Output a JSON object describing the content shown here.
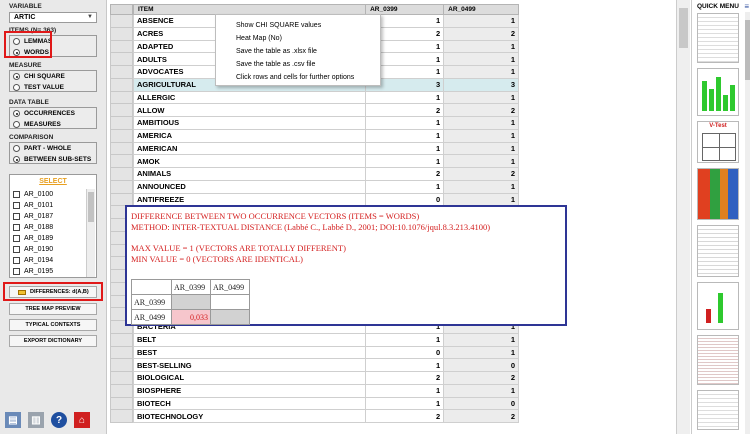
{
  "sidebar": {
    "variable_label": "VARIABLE",
    "variable_value": "ARTIC",
    "items_label": "ITEMS (N= 363)",
    "items_options": [
      "LEMMAS",
      "WORDS"
    ],
    "measure_label": "MEASURE",
    "measure_options": [
      "CHI SQUARE",
      "TEST VALUE"
    ],
    "data_table_label": "DATA TABLE",
    "data_table_options": [
      "OCCURRENCES",
      "MEASURES"
    ],
    "comparison_label": "COMPARISON",
    "comparison_options": [
      "PART - WHOLE",
      "BETWEEN SUB-SETS"
    ],
    "select_label": "SELECT",
    "select_items": [
      "AR_0100",
      "AR_0101",
      "AR_0187",
      "AR_0188",
      "AR_0189",
      "AR_0190",
      "AR_0194",
      "AR_0195"
    ],
    "differences_label": "DIFFERENCES: d(A,B)",
    "buttons": [
      "TREE MAP PREVIEW",
      "TYPICAL CONTEXTS",
      "EXPORT DICTIONARY"
    ]
  },
  "table": {
    "headers": [
      "ITEM",
      "AR_0399",
      "AR_0499"
    ],
    "rows": [
      [
        "ABSENCE",
        "1",
        "1"
      ],
      [
        "ACRES",
        "2",
        "2"
      ],
      [
        "ADAPTED",
        "1",
        "1"
      ],
      [
        "ADULTS",
        "1",
        "1"
      ],
      [
        "ADVOCATES",
        "1",
        "1"
      ],
      [
        "AGRICULTURAL",
        "3",
        "3"
      ],
      [
        "ALLERGIC",
        "1",
        "1"
      ],
      [
        "ALLOW",
        "2",
        "2"
      ],
      [
        "AMBITIOUS",
        "1",
        "1"
      ],
      [
        "AMERICA",
        "1",
        "1"
      ],
      [
        "AMERICAN",
        "1",
        "1"
      ],
      [
        "AMOK",
        "1",
        "1"
      ],
      [
        "ANIMALS",
        "2",
        "2"
      ],
      [
        "ANNOUNCED",
        "1",
        "1"
      ],
      [
        "ANTIFREEZE",
        "0",
        "1"
      ],
      [
        "",
        "",
        ""
      ],
      [
        "",
        "",
        ""
      ],
      [
        "",
        "",
        ""
      ],
      [
        "",
        "",
        ""
      ],
      [
        "",
        "",
        ""
      ],
      [
        "",
        "",
        ""
      ],
      [
        "",
        "",
        ""
      ],
      [
        "",
        "",
        ""
      ],
      [
        "",
        "",
        ""
      ],
      [
        "BACTERIA",
        "1",
        "1"
      ],
      [
        "BELT",
        "1",
        "1"
      ],
      [
        "BEST",
        "0",
        "1"
      ],
      [
        "BEST-SELLING",
        "1",
        "0"
      ],
      [
        "BIOLOGICAL",
        "2",
        "2"
      ],
      [
        "BIOSPHERE",
        "1",
        "1"
      ],
      [
        "BIOTECH",
        "1",
        "0"
      ],
      [
        "BIOTECHNOLOGY",
        "2",
        "2"
      ]
    ]
  },
  "context_menu": [
    "Show CHI SQUARE values",
    "Heat Map (No)",
    "Save the table as .xlsx file",
    "Save the table as .csv file",
    "Click rows and cells for further options"
  ],
  "diff_panel": {
    "line1": "DIFFERENCE BETWEEN TWO OCCURRENCE VECTORS (ITEMS = WORDS)",
    "line2": "METHOD: INTER-TEXTUAL DISTANCE (Labbé C., Labbé D., 2001; DOI:10.1076/jqul.8.3.213.4100)",
    "line3": "MAX VALUE = 1 (VECTORS ARE TOTALLY DIFFERENT)",
    "line4": "MIN VALUE = 0 (VECTORS ARE IDENTICAL)",
    "col_a": "AR_0399",
    "col_b": "AR_0499",
    "row_a": "AR_0399",
    "row_b": "AR_0499",
    "value": "0,033"
  },
  "quick_menu": {
    "title": "QUICK MENU",
    "vtest_label": "V-Test"
  },
  "colors": {
    "red_frame": "#e01818",
    "panel_border": "#2e3595",
    "panel_text": "#d42020",
    "highlight_row": "#d6ebee",
    "select_label": "#e8a020"
  },
  "icons": [
    "document-chart-icon",
    "bar-chart-icon",
    "help-icon",
    "home-icon"
  ]
}
